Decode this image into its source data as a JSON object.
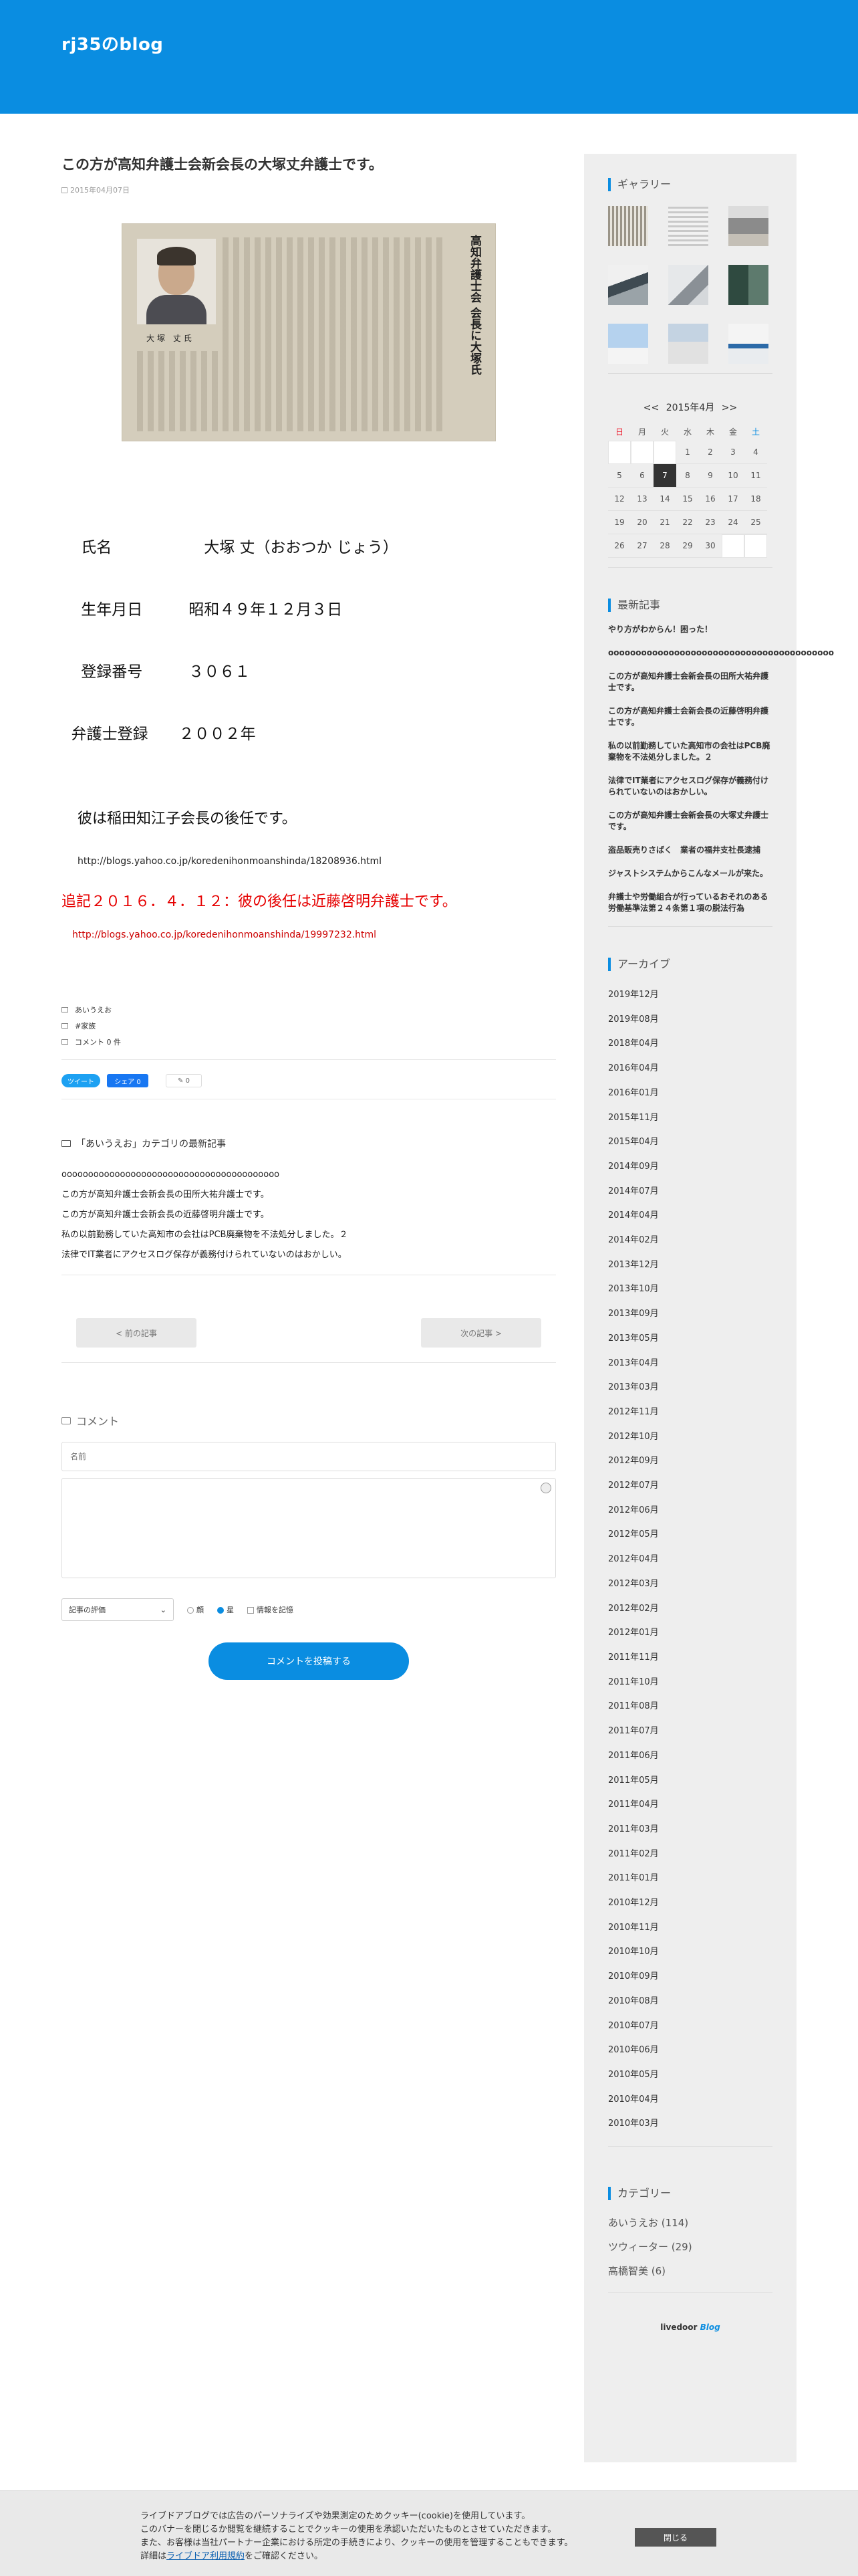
{
  "blog": {
    "title": "rj35のblog"
  },
  "post": {
    "title": "この方が高知弁護士会新会長の大塚丈弁護士です。",
    "date": "2015年04月07日",
    "photo_headline": "高知弁護士会 会長に大塚氏",
    "photo_caption": "大塚 丈氏",
    "info_lines": [
      "    氏名　　　　　　大塚 丈（おおつか じょう）",
      "    生年月日　　　昭和４９年１２月３日",
      "    登録番号　　　３０６１",
      "  弁護士登録　　２００２年"
    ],
    "successor": "彼は稲田知江子会長の後任です。",
    "link1": "http://blogs.yahoo.co.jp/koredenihonmoanshinda/18208936.html",
    "update": "追記２０１６．４．１２：彼の後任は近藤啓明弁護士です。",
    "link2": "http://blogs.yahoo.co.jp/koredenihonmoanshinda/19997232.html",
    "category": "あいうえお",
    "tag": "#家族",
    "comments": "コメント  0 件"
  },
  "share": {
    "twitter": "ツイート",
    "facebook": "シェア 0",
    "hatena": "0"
  },
  "latest": {
    "heading": "「あいうえお」カテゴリの最新記事",
    "items": [
      "ooooooooooooooooooooooooooooooooooooooooo",
      "この方が高知弁護士会新会長の田所大祐弁護士です。",
      "この方が高知弁護士会新会長の近藤啓明弁護士です。",
      "私の以前勤務していた高知市の会社はPCB廃棄物を不法処分しました。２",
      "法律でIT業者にアクセスログ保存が義務付けられていないのはおかしい。"
    ]
  },
  "pager": {
    "prev": "< 前の記事",
    "next": "次の記事 >"
  },
  "comment_form": {
    "heading": "コメント",
    "name_placeholder": "名前",
    "rating_label": "記事の評価",
    "rating_opt_bad": "顔",
    "rating_opt_star": "星",
    "remember": "情報を記憶",
    "submit": "コメントを投稿する"
  },
  "sidebar": {
    "gallery_title": "ギャラリー",
    "calendar": {
      "prev": "<<",
      "month": "2015年4月",
      "next": ">>",
      "dows": [
        "日",
        "月",
        "火",
        "水",
        "木",
        "金",
        "土"
      ],
      "rows": [
        [
          "",
          "",
          "",
          "1",
          "2",
          "3",
          "4"
        ],
        [
          "5",
          "6",
          "7",
          "8",
          "9",
          "10",
          "11"
        ],
        [
          "12",
          "13",
          "14",
          "15",
          "16",
          "17",
          "18"
        ],
        [
          "19",
          "20",
          "21",
          "22",
          "23",
          "24",
          "25"
        ],
        [
          "26",
          "27",
          "28",
          "29",
          "30",
          "",
          ""
        ]
      ],
      "today": "7"
    },
    "recent_title": "最新記事",
    "recent": [
      "やり方がわからん！困った！",
      "ooooooooooooooooooooooooooooooooooooooooo",
      "この方が高知弁護士会新会長の田所大祐弁護士です。",
      "この方が高知弁護士会新会長の近藤啓明弁護士です。",
      "私の以前勤務していた高知市の会社はPCB廃棄物を不法処分しました。２",
      "法律でIT業者にアクセスログ保存が義務付けられていないのはおかしい。",
      "この方が高知弁護士会新会長の大塚丈弁護士です。",
      "盗品販売りさばく　業者の福井支社長逮捕",
      "ジャストシステムからこんなメールが来た。",
      "弁護士や労働組合が行っているおそれのある労働基準法第２４条第１項の脱法行為"
    ],
    "archive_title": "アーカイブ",
    "archives": [
      "2019年12月",
      "2019年08月",
      "2018年04月",
      "2016年04月",
      "2016年01月",
      "2015年11月",
      "2015年04月",
      "2014年09月",
      "2014年07月",
      "2014年04月",
      "2014年02月",
      "2013年12月",
      "2013年10月",
      "2013年09月",
      "2013年05月",
      "2013年04月",
      "2013年03月",
      "2012年11月",
      "2012年10月",
      "2012年09月",
      "2012年07月",
      "2012年06月",
      "2012年05月",
      "2012年04月",
      "2012年03月",
      "2012年02月",
      "2012年01月",
      "2011年11月",
      "2011年10月",
      "2011年08月",
      "2011年07月",
      "2011年06月",
      "2011年05月",
      "2011年04月",
      "2011年03月",
      "2011年02月",
      "2011年01月",
      "2010年12月",
      "2010年11月",
      "2010年10月",
      "2010年09月",
      "2010年08月",
      "2010年07月",
      "2010年06月",
      "2010年05月",
      "2010年04月",
      "2010年03月"
    ],
    "category_title": "カテゴリー",
    "categories": [
      "あいうえお (114)",
      "ツウィーター (29)",
      "高橋智美 (6)"
    ],
    "livedoor_a": "livedoor",
    "livedoor_b": "Blog"
  },
  "cookie": {
    "line1": "ライブドアブログでは広告のパーソナライズや効果測定のためクッキー(cookie)を使用しています。",
    "line2": "このバナーを閉じるか閲覧を継続することでクッキーの使用を承認いただいたものとさせていただきます。",
    "line3": "また、お客様は当社パートナー企業における所定の手続きにより、クッキーの使用を管理することもできます。",
    "line4_pre": "詳細は",
    "line4_link": "ライブドア利用規約",
    "line4_post": "をご確認ください。",
    "close": "閉じる"
  },
  "colors": {
    "accent": "#0a8de1",
    "red": "#e60000"
  }
}
